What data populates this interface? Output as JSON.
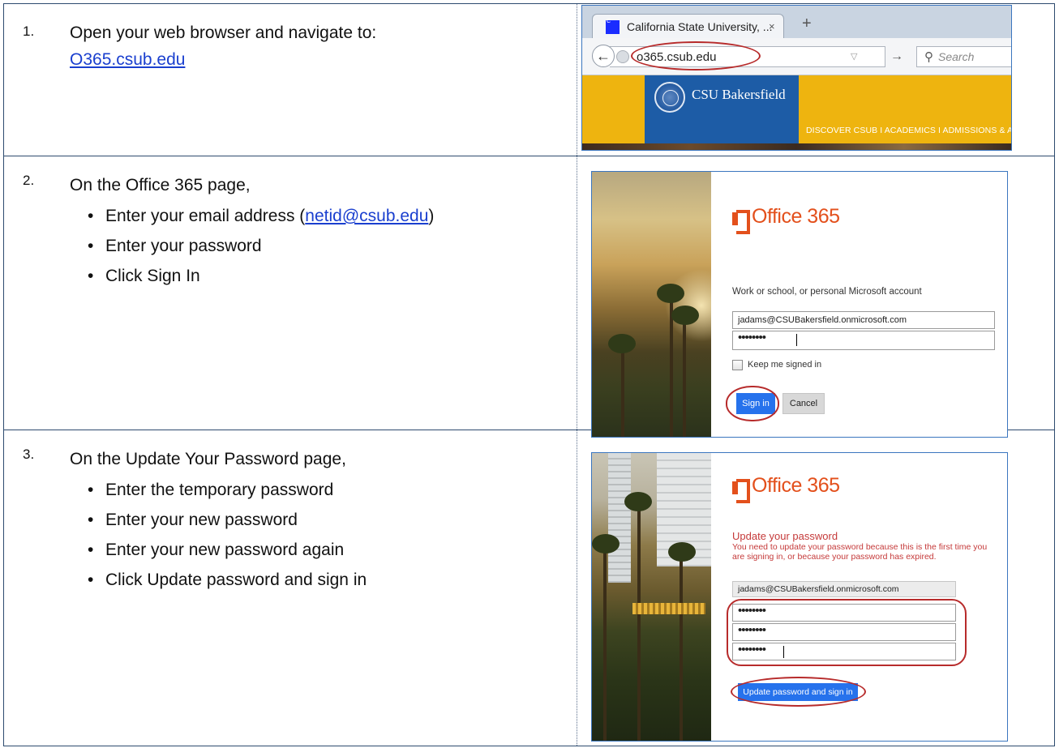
{
  "steps": [
    {
      "number": "1.",
      "title": "Open your web browser and navigate to:",
      "link": "O365.csub.edu"
    },
    {
      "number": "2.",
      "title": "On the Office 365 page,",
      "bullets": {
        "email_prefix": "Enter your email address (",
        "email_link": "netid@csub.edu",
        "email_suffix": ")",
        "password": "Enter your password",
        "signin": "Click Sign In"
      }
    },
    {
      "number": "3.",
      "title": "On the Update Your Password page,",
      "bullets": [
        "Enter the temporary password",
        "Enter your new password",
        "Enter your new password again",
        "Click Update password and sign in"
      ]
    }
  ],
  "browser": {
    "tab_title": "California State University, ...",
    "tab_close": "×",
    "new_tab": "+",
    "back": "←",
    "url": "o365.csub.edu",
    "url_dropdown": "▽",
    "go": "→",
    "search_icon": "🔍",
    "search_placeholder": "Search",
    "site_name": "CSU Bakersfield",
    "site_nav": "DISCOVER CSUB  I  ACADEMICS  I  ADMISSIONS & AID  I"
  },
  "signin": {
    "brand": "Office 365",
    "prompt": "Work or school, or personal Microsoft account",
    "email_value": "jadams@CSUBakersfield.onmicrosoft.com",
    "password_mask": "••••••••",
    "keep_signed_in": "Keep me signed in",
    "signin_button": "Sign in",
    "cancel_button": "Cancel"
  },
  "update": {
    "brand": "Office 365",
    "heading": "Update your password",
    "message_line1": "You need to update your password because this is the first time you",
    "message_line2": "are signing in, or because your password has expired.",
    "email_value": "jadams@CSUBakersfield.onmicrosoft.com",
    "temp_mask": "••••••••",
    "new_mask": "••••••••",
    "confirm_mask": "••••••••",
    "submit_button": "Update password and sign in"
  },
  "colors": {
    "table_border": "#2d4a6e",
    "link": "#1a3fcf",
    "office_orange": "#e3501c",
    "highlight_red": "#b72b2b",
    "button_blue": "#2672ec",
    "csub_gold": "#eeb40f",
    "csub_blue": "#1d5ca6"
  }
}
